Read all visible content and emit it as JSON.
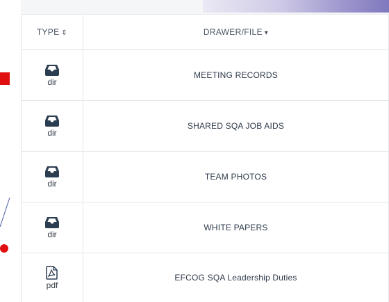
{
  "table": {
    "headers": {
      "type": "TYPE",
      "type_sort": "⇕",
      "file": "DRAWER/FILE",
      "file_sort": "▾"
    },
    "rows": [
      {
        "type": "dir",
        "icon": "drawer-icon",
        "name": "MEETING RECORDS"
      },
      {
        "type": "dir",
        "icon": "drawer-icon",
        "name": "SHARED SQA JOB AIDS"
      },
      {
        "type": "dir",
        "icon": "drawer-icon",
        "name": "TEAM PHOTOS"
      },
      {
        "type": "dir",
        "icon": "drawer-icon",
        "name": "WHITE PAPERS"
      },
      {
        "type": "pdf",
        "icon": "pdf-icon",
        "name": "EFCOG SQA Leadership Duties"
      }
    ]
  },
  "colors": {
    "icon": "#2b3d50",
    "annotation_red": "#e01010",
    "annotation_line": "#4a5aa8",
    "border": "#e3e6ea"
  }
}
